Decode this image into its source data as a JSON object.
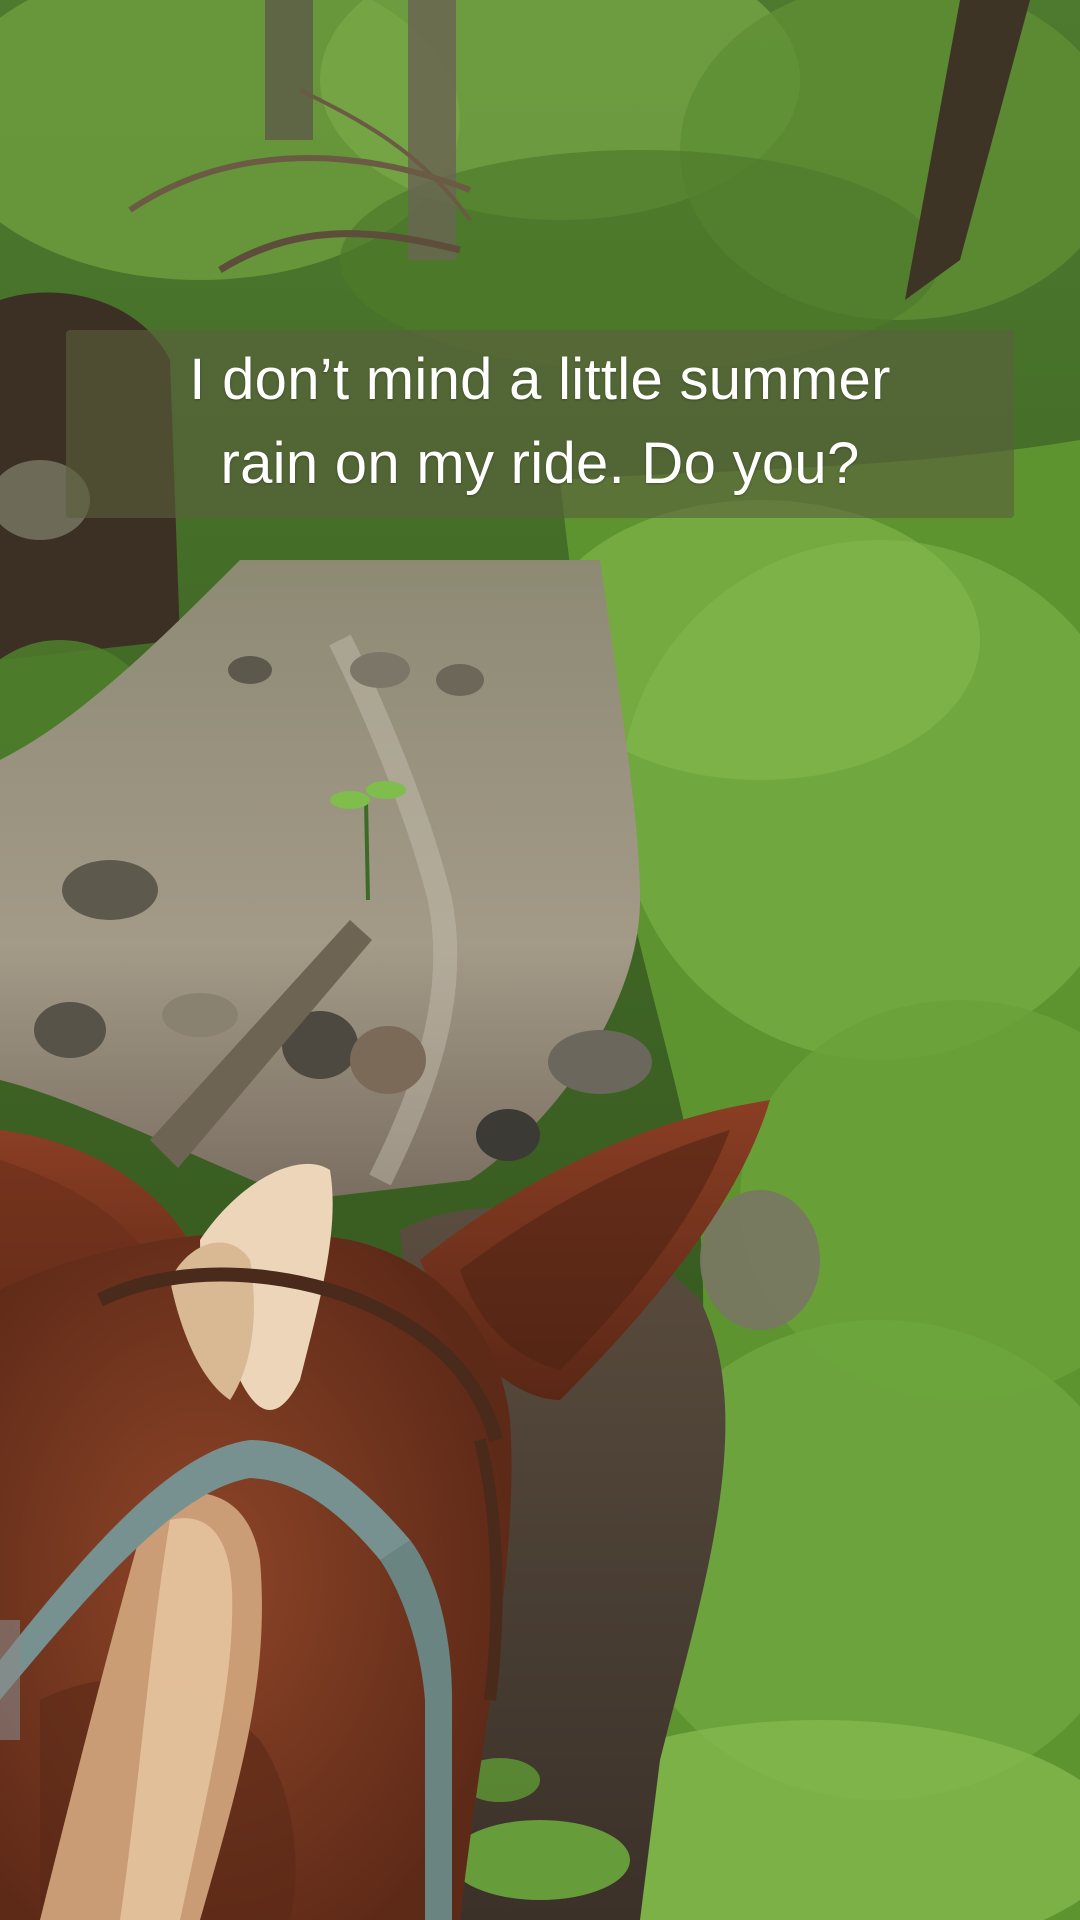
{
  "caption": {
    "line1": "I don’t mind a little summer",
    "line2": "rain on my ride. Do you?"
  },
  "scene": {
    "description_icon": "horse-ears-trail-photo",
    "colors": {
      "foliage": "#4f7e2c",
      "foliage_light": "#7fb04a",
      "creek": "#9a9482",
      "mud": "#4a3f35",
      "horse_coat": "#7a3a22",
      "horse_mane": "#e8c9a8",
      "halter": "#6f8a8c",
      "caption_bg": "#5a5f3c"
    }
  }
}
